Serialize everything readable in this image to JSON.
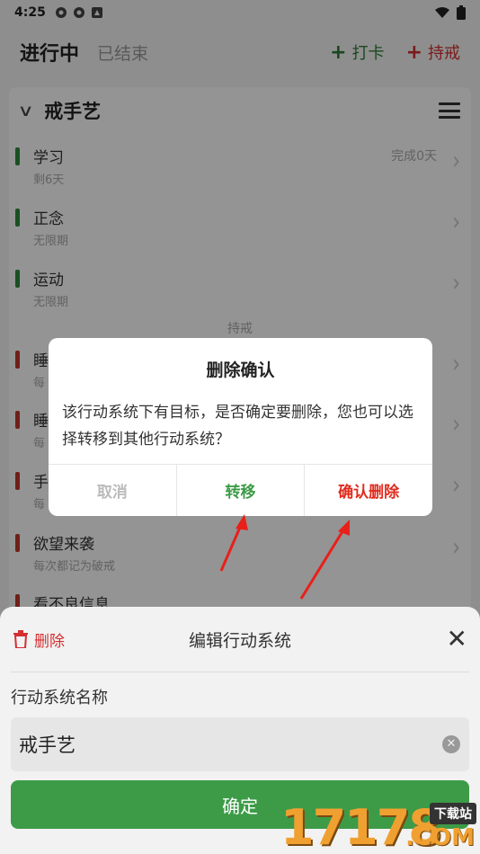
{
  "status_bar": {
    "time": "4:25"
  },
  "tabs": {
    "active": "进行中",
    "inactive": "已结束"
  },
  "actions": {
    "checkin": "打卡",
    "abstain": "持戒"
  },
  "card": {
    "title": "戒手艺",
    "items": [
      {
        "name": "学习",
        "sub": "剩6天",
        "meta": "完成0天",
        "color": "#2e8b3e"
      },
      {
        "name": "正念",
        "sub": "无限期",
        "color": "#2e8b3e"
      },
      {
        "name": "运动",
        "sub": "无限期",
        "color": "#2e8b3e"
      }
    ],
    "section_label": "持戒",
    "abstain_items": [
      {
        "name": "睡",
        "sub": "每",
        "color": "#c0392b"
      },
      {
        "name": "睡",
        "sub": "每",
        "color": "#c0392b"
      },
      {
        "name": "手",
        "sub": "每",
        "color": "#c0392b"
      },
      {
        "name": "欲望来袭",
        "sub": "每次都记为破戒",
        "color": "#c0392b"
      },
      {
        "name": "看不良信息",
        "color": "#c0392b"
      }
    ]
  },
  "dialog": {
    "title": "删除确认",
    "message": "该行动系统下有目标，是否确定要删除，您也可以选择转移到其他行动系统？",
    "cancel": "取消",
    "move": "转移",
    "confirm_delete": "确认删除"
  },
  "sheet": {
    "delete_label": "删除",
    "title": "编辑行动系统",
    "field_label": "行动系统名称",
    "field_value": "戒手艺",
    "confirm": "确定"
  },
  "watermark": {
    "digits": "17178",
    "tag": "下载站",
    "suffix": ".COM"
  },
  "colors": {
    "green": "#3d9b47",
    "red": "#e02b1c",
    "annotation_arrow": "#e8201a"
  }
}
